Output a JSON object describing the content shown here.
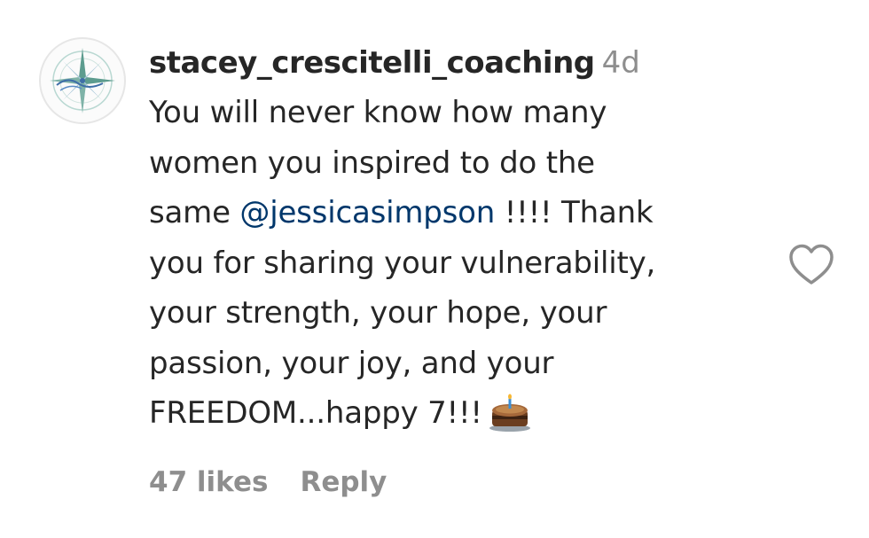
{
  "comment": {
    "username": "stacey_crescitelli_coaching",
    "timestamp": "4d",
    "body_lines": [
      {
        "before": "You will never know how many",
        "mention": "",
        "after": ""
      },
      {
        "before": "women you inspired to do the",
        "mention": "",
        "after": ""
      },
      {
        "before": "same ",
        "mention": "@jessicasimpson",
        "after": " !!!! Thank"
      },
      {
        "before": "you for sharing your vulnerability,",
        "mention": "",
        "after": ""
      },
      {
        "before": "your strength, your hope, your",
        "mention": "",
        "after": ""
      },
      {
        "before": "passion, your joy, and your",
        "mention": "",
        "after": ""
      },
      {
        "before": "FREEDOM...happy 7!!!",
        "mention": "",
        "after": ""
      }
    ],
    "emoji": "cake-emoji",
    "likes": "47 likes",
    "reply_label": "Reply",
    "like_icon": "heart-outline-icon",
    "colors": {
      "text": "#262626",
      "secondary": "#8e8e8e",
      "mention": "#00376b"
    }
  }
}
